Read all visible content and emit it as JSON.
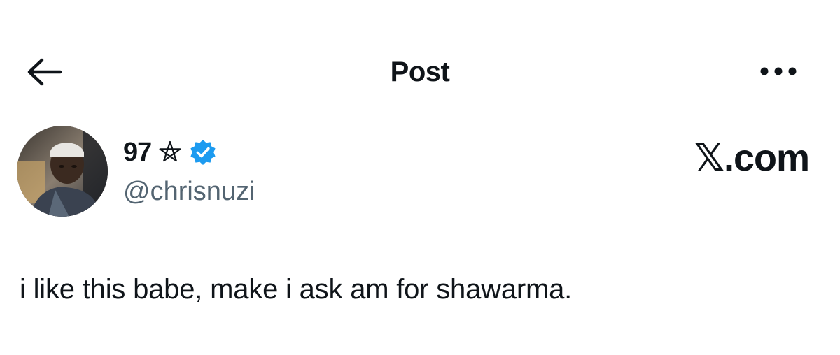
{
  "header": {
    "title": "Post",
    "back_icon": "arrow-left-icon",
    "more_icon": "more-horizontal-icon"
  },
  "author": {
    "name": "97",
    "emblem_icon": "pentagram-icon",
    "verified_icon": "verified-badge-icon",
    "handle": "@chrisnuzi",
    "avatar": "avatar-photo"
  },
  "brand": {
    "label": "𝕏.com"
  },
  "post": {
    "text": "i like this babe, make i ask am for shawarma."
  },
  "colors": {
    "text": "#0f1419",
    "secondary_text": "#536471",
    "verified": "#1d9bf0",
    "background": "#ffffff"
  }
}
